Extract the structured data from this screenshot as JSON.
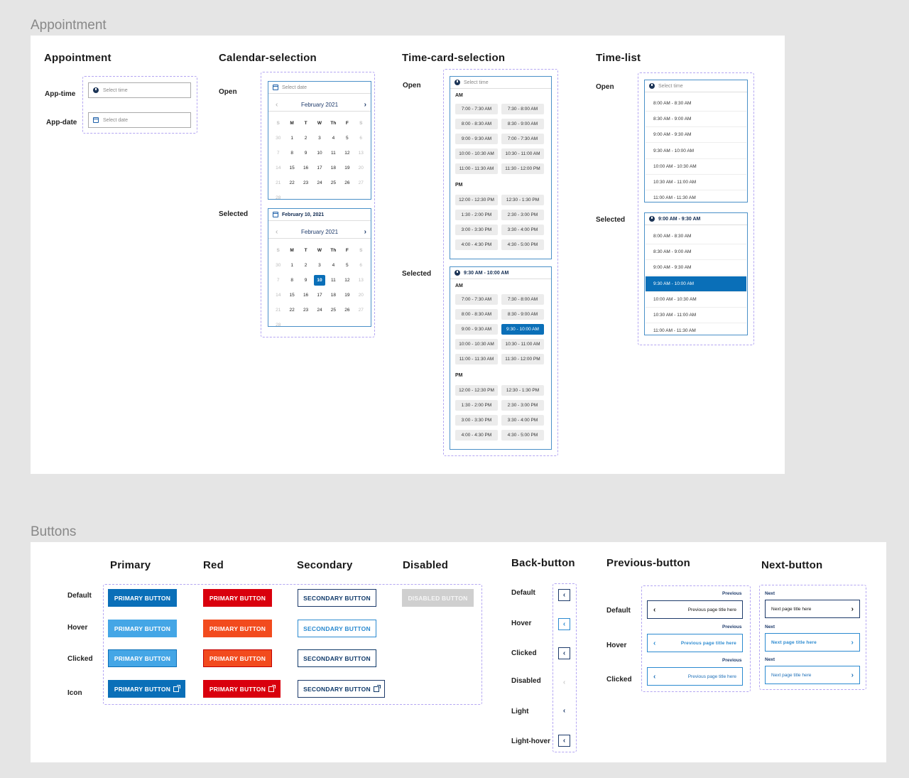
{
  "appointment_frame": {
    "frame_title": "Appointment",
    "sections": {
      "appointment": "Appointment",
      "calendar_selection": "Calendar-selection",
      "time_card_selection": "Time-card-selection",
      "time_list": "Time-list"
    },
    "labels": {
      "app_time": "App-time",
      "app_date": "App-date",
      "open": "Open",
      "selected": "Selected"
    },
    "inputs": {
      "time_placeholder": "Select time",
      "date_placeholder": "Select date"
    },
    "calendar": {
      "month": "February 2021",
      "selected_date_value": "February 10, 2021",
      "weekdays": [
        "S",
        "M",
        "T",
        "W",
        "Th",
        "F",
        "S"
      ],
      "weeks": [
        [
          "30",
          "1",
          "2",
          "3",
          "4",
          "5",
          "6"
        ],
        [
          "7",
          "8",
          "9",
          "10",
          "11",
          "12",
          "13"
        ],
        [
          "14",
          "15",
          "16",
          "17",
          "18",
          "19",
          "20"
        ],
        [
          "21",
          "22",
          "23",
          "24",
          "25",
          "26",
          "27"
        ],
        [
          "28",
          "",
          "",
          "",
          "",
          "",
          ""
        ]
      ],
      "selected_day": "10"
    },
    "time_cards": {
      "am_label": "AM",
      "pm_label": "PM",
      "am_slots": [
        "7:00 - 7:30 AM",
        "7:30 - 8:00 AM",
        "8:00 - 8:30 AM",
        "8:30 - 9:00 AM",
        "9:00 - 9:30 AM",
        "7:00 - 7:30 AM",
        "10:00 - 10:30 AM",
        "10:30 - 11:00 AM",
        "11:00 - 11:30 AM",
        "11:30 - 12:00 PM"
      ],
      "am_slots_selected": [
        "7:00 - 7:30 AM",
        "7:30 - 8:00 AM",
        "8:00 - 8:30 AM",
        "8:30 - 9:00 AM",
        "9:00 - 9:30 AM",
        "9:30 - 10:00 AM",
        "10:00 - 10:30 AM",
        "10:30 - 11:00 AM",
        "11:00 - 11:30 AM",
        "11:30 - 12:00 PM"
      ],
      "pm_slots": [
        "12:00 - 12:30 PM",
        "12:30 - 1:30 PM",
        "1:30 - 2:00 PM",
        "2:30 - 3:00 PM",
        "3:00 - 3:30 PM",
        "3:30 - 4:00 PM",
        "4:00 - 4:30 PM",
        "4:30 - 5:00 PM"
      ],
      "selected_value": "9:30 AM - 10:00 AM",
      "selected_slot_index": 5
    },
    "time_list": {
      "items": [
        "8:00 AM - 8:30 AM",
        "8:30 AM - 9:00 AM",
        "9:00 AM - 9:30 AM",
        "9:30 AM - 10:00 AM",
        "10:00 AM - 10:30 AM",
        "10:30 AM - 11:00 AM",
        "11:00 AM - 11:30 AM"
      ],
      "selected_value": "9:00 AM - 9:30 AM",
      "selected_index": 3
    }
  },
  "buttons_frame": {
    "frame_title": "Buttons",
    "columns": {
      "primary": "Primary",
      "red": "Red",
      "secondary": "Secondary",
      "disabled": "Disabled",
      "back": "Back-button",
      "previous": "Previous-button",
      "next": "Next-button"
    },
    "states": {
      "default": "Default",
      "hover": "Hover",
      "clicked": "Clicked",
      "icon": "Icon",
      "disabled": "Disabled",
      "light": "Light",
      "light_hover": "Light-hover"
    },
    "labels": {
      "primary": "PRIMARY BUTTON",
      "secondary": "SECONDARY BUTTON",
      "disabled": "DISABLED BUTTON"
    },
    "nav": {
      "previous_small": "Previous",
      "previous_title": "Previous page title here",
      "next_small": "Next",
      "next_title": "Next page title here"
    },
    "colors": {
      "primary": "#0a6fb8",
      "primary_hover": "#44a6e6",
      "red": "#d9000d",
      "red_hover": "#f24b1e",
      "navy": "#1d3a6a",
      "disabled": "#cfcfcf"
    }
  }
}
